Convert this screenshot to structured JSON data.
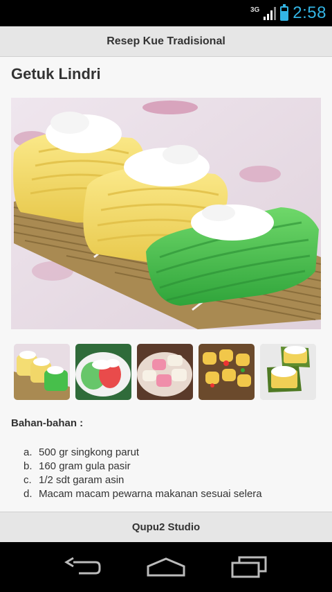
{
  "status_bar": {
    "network": "3G",
    "time": "2:58",
    "battery_level": 0.7,
    "signal_bars": 3,
    "icons": [
      "signal-icon",
      "battery-icon"
    ]
  },
  "app": {
    "title": "Resep Kue Tradisional"
  },
  "recipe": {
    "title": "Getuk Lindri",
    "hero_image": "getuk-lindri-photo",
    "thumbnails": [
      "getuk-lindri-thumbnail",
      "green-pink-cake-thumbnail",
      "pink-white-cake-thumbnail",
      "yellow-cake-rolls-thumbnail",
      "banana-leaf-cake-thumbnail"
    ],
    "ingredients_heading": "Bahan-bahan :",
    "ingredients": [
      {
        "marker": "a.",
        "text": "500 gr singkong parut"
      },
      {
        "marker": "b.",
        "text": "160 gram gula pasir"
      },
      {
        "marker": "c.",
        "text": "1/2 sdt garam asin"
      },
      {
        "marker": "d.",
        "text": "Macam macam pewarna makanan sesuai selera"
      }
    ]
  },
  "footer": {
    "label": "Qupu2 Studio"
  },
  "nav": {
    "icons": [
      "back-icon",
      "home-icon",
      "recent-apps-icon"
    ]
  },
  "colors": {
    "accent": "#33b5e5",
    "bar_background": "#e6e6e6",
    "content_background": "#f7f7f7"
  }
}
